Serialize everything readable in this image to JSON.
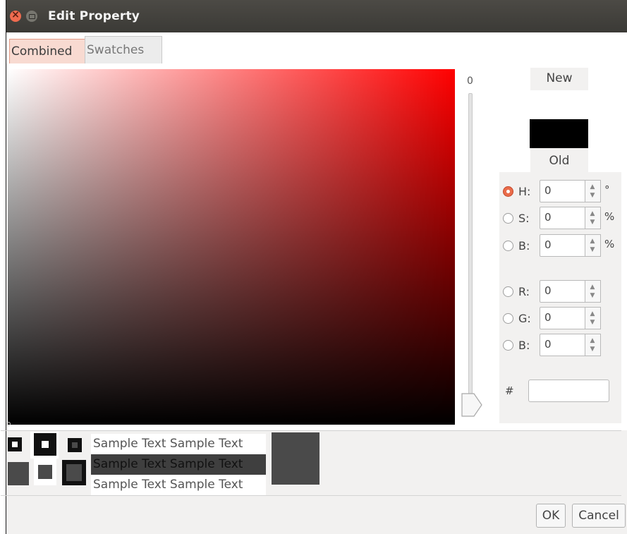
{
  "window": {
    "title": "Edit Property"
  },
  "tabs": [
    {
      "label": "Combined",
      "active": true
    },
    {
      "label": "Swatches",
      "active": false
    }
  ],
  "color_field": {
    "hue_color": "#ff0000"
  },
  "hue_slider": {
    "label": "0"
  },
  "swatches": {
    "new_label": "New",
    "old_label": "Old",
    "new_color": "#ffffff",
    "old_color": "#000000"
  },
  "hsb": [
    {
      "label": "H:",
      "value": "0",
      "unit": "°",
      "selected": true
    },
    {
      "label": "S:",
      "value": "0",
      "unit": "%",
      "selected": false
    },
    {
      "label": "B:",
      "value": "0",
      "unit": "%",
      "selected": false
    }
  ],
  "rgb": [
    {
      "label": "R:",
      "value": "0",
      "selected": false
    },
    {
      "label": "G:",
      "value": "0",
      "selected": false
    },
    {
      "label": "B:",
      "value": "0",
      "selected": false
    }
  ],
  "hex": {
    "label": "#",
    "value": ""
  },
  "preview": {
    "lines": [
      "Sample Text  Sample Text",
      "Sample Text  Sample Text",
      "Sample Text  Sample Text"
    ],
    "preview_color": "#4a4a4a"
  },
  "buttons": {
    "ok": "OK",
    "cancel": "Cancel"
  },
  "colors": {
    "accent": "#ea6c4a",
    "titlebar": "#3b3a36",
    "tab_active_bg": "#f8dad1"
  }
}
